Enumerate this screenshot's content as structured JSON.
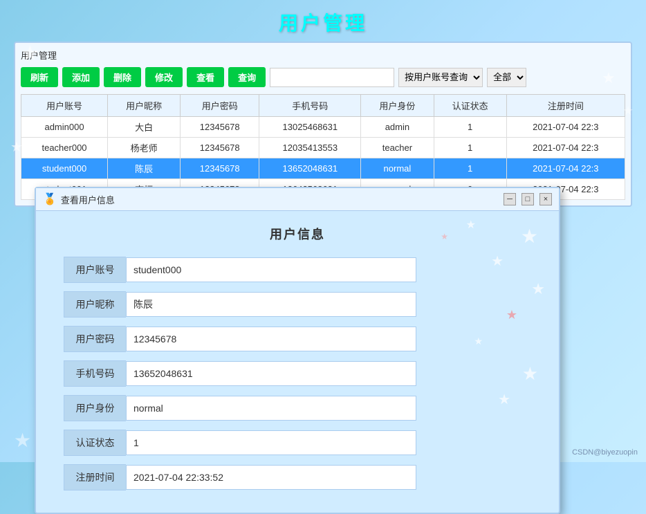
{
  "app": {
    "title": "用户管理",
    "panel_title": "用户管理"
  },
  "toolbar": {
    "btn_refresh": "刷新",
    "btn_add": "添加",
    "btn_delete": "删除",
    "btn_edit": "修改",
    "btn_view": "查看",
    "btn_query": "查询",
    "search_placeholder": "",
    "query_option": "按用户账号查询",
    "filter_option": "全部"
  },
  "table": {
    "headers": [
      "用户账号",
      "用户昵称",
      "用户密码",
      "手机号码",
      "用户身份",
      "认证状态",
      "注册时间"
    ],
    "rows": [
      {
        "account": "admin000",
        "nickname": "大白",
        "password": "12345678",
        "phone": "13025468631",
        "role": "admin",
        "auth": "1",
        "regtime": "2021-07-04 22:3",
        "selected": false
      },
      {
        "account": "teacher000",
        "nickname": "杨老师",
        "password": "12345678",
        "phone": "12035413553",
        "role": "teacher",
        "auth": "1",
        "regtime": "2021-07-04 22:3",
        "selected": false
      },
      {
        "account": "student000",
        "nickname": "陈辰",
        "password": "12345678",
        "phone": "13652048631",
        "role": "normal",
        "auth": "1",
        "regtime": "2021-07-04 22:3",
        "selected": true
      },
      {
        "account": "student001",
        "nickname": "李桓",
        "password": "12345678",
        "phone": "13642568631",
        "role": "normal",
        "auth": "0",
        "regtime": "2021-07-04 22:3",
        "selected": false
      }
    ]
  },
  "dialog": {
    "title": "查看用户信息",
    "heading": "用户信息",
    "icon": "🏅",
    "fields": [
      {
        "label": "用户账号",
        "value": "student000"
      },
      {
        "label": "用户昵称",
        "value": "陈辰"
      },
      {
        "label": "用户密码",
        "value": "12345678"
      },
      {
        "label": "手机号码",
        "value": "13652048631"
      },
      {
        "label": "用户身份",
        "value": "normal"
      },
      {
        "label": "认证状态",
        "value": "1"
      },
      {
        "label": "注册时间",
        "value": "2021-07-04 22:33:52"
      }
    ],
    "ctrl_min": "─",
    "ctrl_max": "□",
    "ctrl_close": "×"
  },
  "watermark": "CSDN@biyezuopin"
}
